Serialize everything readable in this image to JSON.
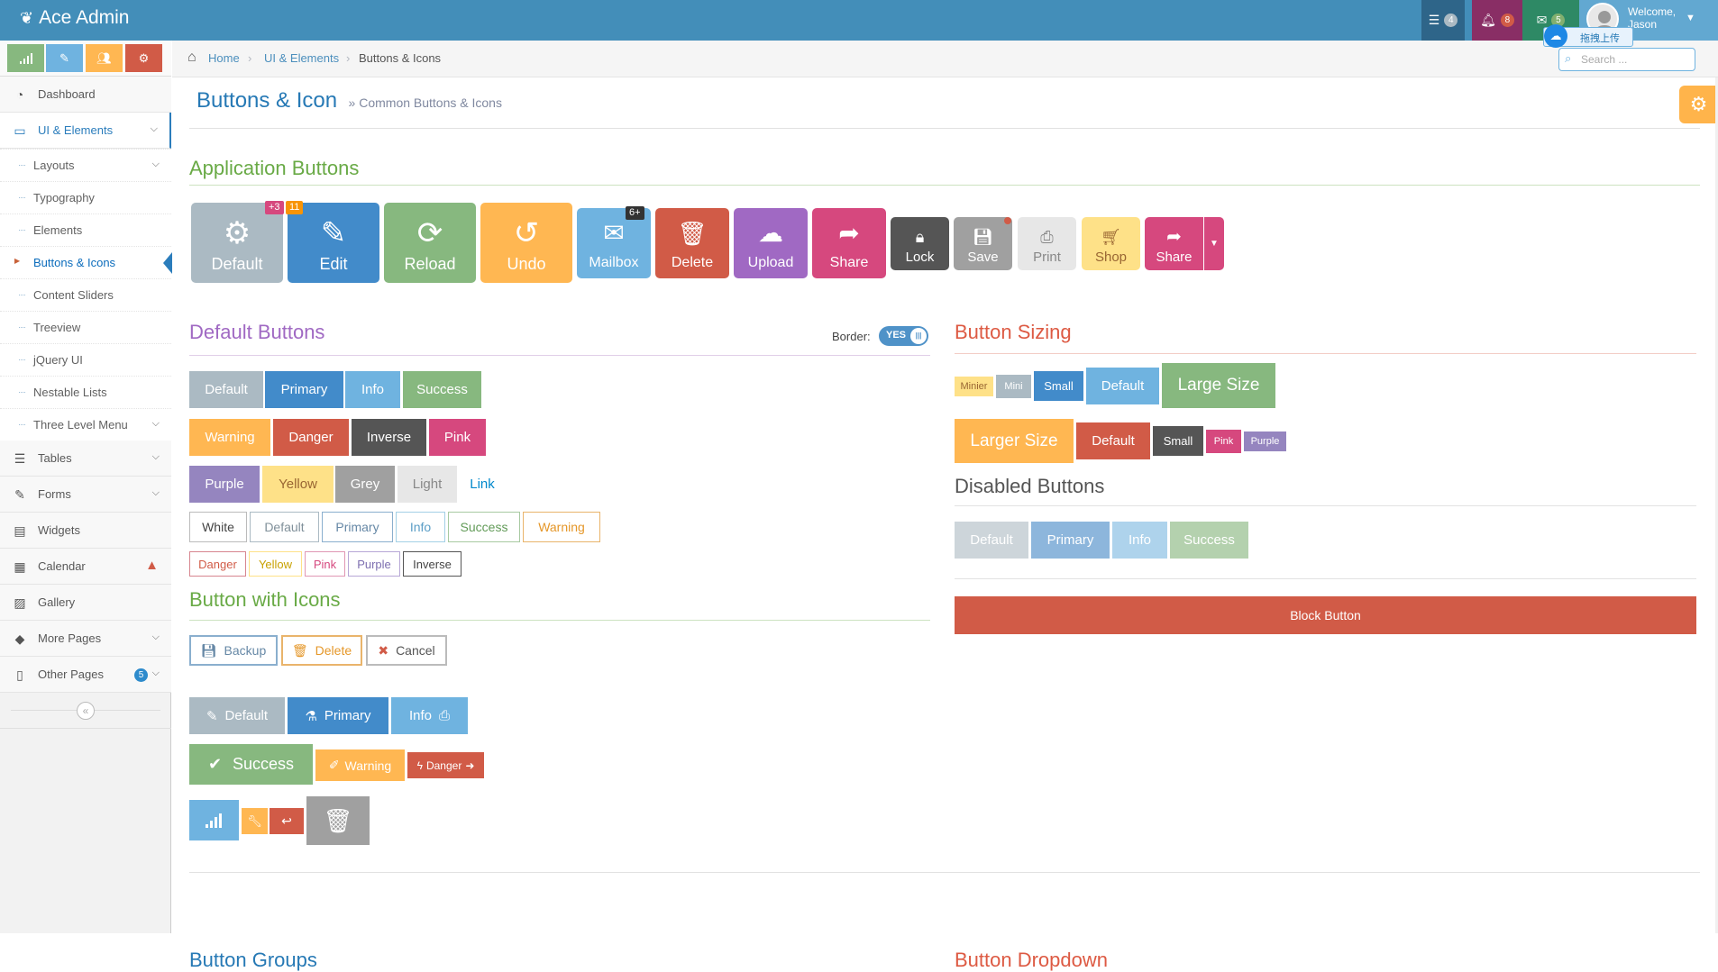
{
  "navbar": {
    "brand": "Ace Admin",
    "tasks_count": "4",
    "notifications_count": "8",
    "messages_count": "5",
    "welcome_line1": "Welcome,",
    "welcome_line2": "Jason",
    "upload_widget": "拖拽上传"
  },
  "sidebar": {
    "items": [
      {
        "label": "Dashboard"
      },
      {
        "label": "UI & Elements"
      },
      {
        "label": "Tables"
      },
      {
        "label": "Forms"
      },
      {
        "label": "Widgets"
      },
      {
        "label": "Calendar"
      },
      {
        "label": "Gallery"
      },
      {
        "label": "More Pages"
      },
      {
        "label": "Other Pages"
      }
    ],
    "sub_items": [
      {
        "label": "Layouts"
      },
      {
        "label": "Typography"
      },
      {
        "label": "Elements"
      },
      {
        "label": "Buttons & Icons"
      },
      {
        "label": "Content Sliders"
      },
      {
        "label": "Treeview"
      },
      {
        "label": "jQuery UI"
      },
      {
        "label": "Nestable Lists"
      },
      {
        "label": "Three Level Menu"
      }
    ],
    "other_pages_badge": "5"
  },
  "breadcrumb": {
    "home": "Home",
    "section": "UI & Elements",
    "current": "Buttons & Icons"
  },
  "search": {
    "placeholder": "Search ..."
  },
  "page": {
    "title": "Buttons & Icon",
    "subtitle": "» Common Buttons & Icons"
  },
  "sections": {
    "application": "Application Buttons",
    "default": "Default Buttons",
    "border_label": "Border:",
    "border_toggle": "YES",
    "sizing": "Button Sizing",
    "disabled": "Disabled Buttons",
    "with_icons": "Button with Icons",
    "groups": "Button Groups",
    "dropdown": "Button Dropdown"
  },
  "app_buttons": {
    "default": "Default",
    "default_badge": "+3",
    "edit": "Edit",
    "edit_badge": "11",
    "reload": "Reload",
    "undo": "Undo",
    "mailbox": "Mailbox",
    "mailbox_badge": "6+",
    "delete": "Delete",
    "upload": "Upload",
    "share": "Share",
    "lock": "Lock",
    "save": "Save",
    "print": "Print",
    "shop": "Shop",
    "share2": "Share"
  },
  "default_buttons": {
    "row1": [
      "Default",
      "Primary",
      "Info",
      "Success"
    ],
    "row2": [
      "Warning",
      "Danger",
      "Inverse",
      "Pink"
    ],
    "row3": [
      "Purple",
      "Yellow",
      "Grey",
      "Light",
      "Link"
    ],
    "row4": [
      "White",
      "Default",
      "Primary",
      "Info",
      "Success",
      "Warning"
    ],
    "row5": [
      "Danger",
      "Yellow",
      "Pink",
      "Purple",
      "Inverse"
    ]
  },
  "sizing_buttons": {
    "row1": [
      "Minier",
      "Mini",
      "Small",
      "Default",
      "Large Size"
    ],
    "row2": [
      "Larger Size",
      "Default",
      "Small",
      "Pink",
      "Purple"
    ]
  },
  "disabled_buttons": [
    "Default",
    "Primary",
    "Info",
    "Success"
  ],
  "block_button": "Block Button",
  "icon_buttons": {
    "row1": [
      "Backup",
      "Delete",
      "Cancel"
    ],
    "row2": [
      "Default",
      "Primary",
      "Info"
    ],
    "row3": [
      "Success",
      "Warning",
      "Danger"
    ]
  }
}
